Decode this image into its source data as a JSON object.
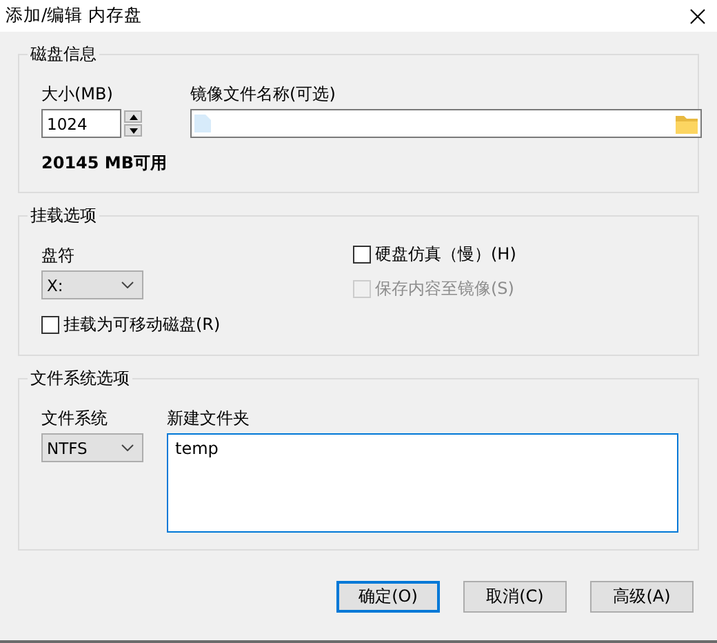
{
  "window": {
    "title": "添加/编辑 内存盘"
  },
  "disk_info": {
    "title": "磁盘信息",
    "size": {
      "label": "大小(MB)",
      "value": "1024"
    },
    "free_space": "20145 MB可用",
    "image_file": {
      "label": "镜像文件名称(可选)"
    }
  },
  "mount_options": {
    "title": "挂载选项",
    "drive_letter": {
      "label": "盘符",
      "value": "X:"
    },
    "removable": {
      "label": "挂载为可移动磁盘(R)",
      "checked": false,
      "disabled": false
    },
    "hard_disk_emulation": {
      "label": "硬盘仿真（慢）(H)",
      "checked": false,
      "disabled": false
    },
    "save_to_image": {
      "label": "保存内容至镜像(S)",
      "checked": false,
      "disabled": true
    }
  },
  "filesystem_options": {
    "title": "文件系统选项",
    "filesystem": {
      "label": "文件系统",
      "value": "NTFS"
    },
    "new_folder": {
      "label": "新建文件夹",
      "value": "temp"
    }
  },
  "buttons": [
    {
      "label": "确定(O)",
      "default": true
    },
    {
      "label": "取消(C)",
      "default": false
    },
    {
      "label": "高级(A)",
      "default": false
    }
  ]
}
